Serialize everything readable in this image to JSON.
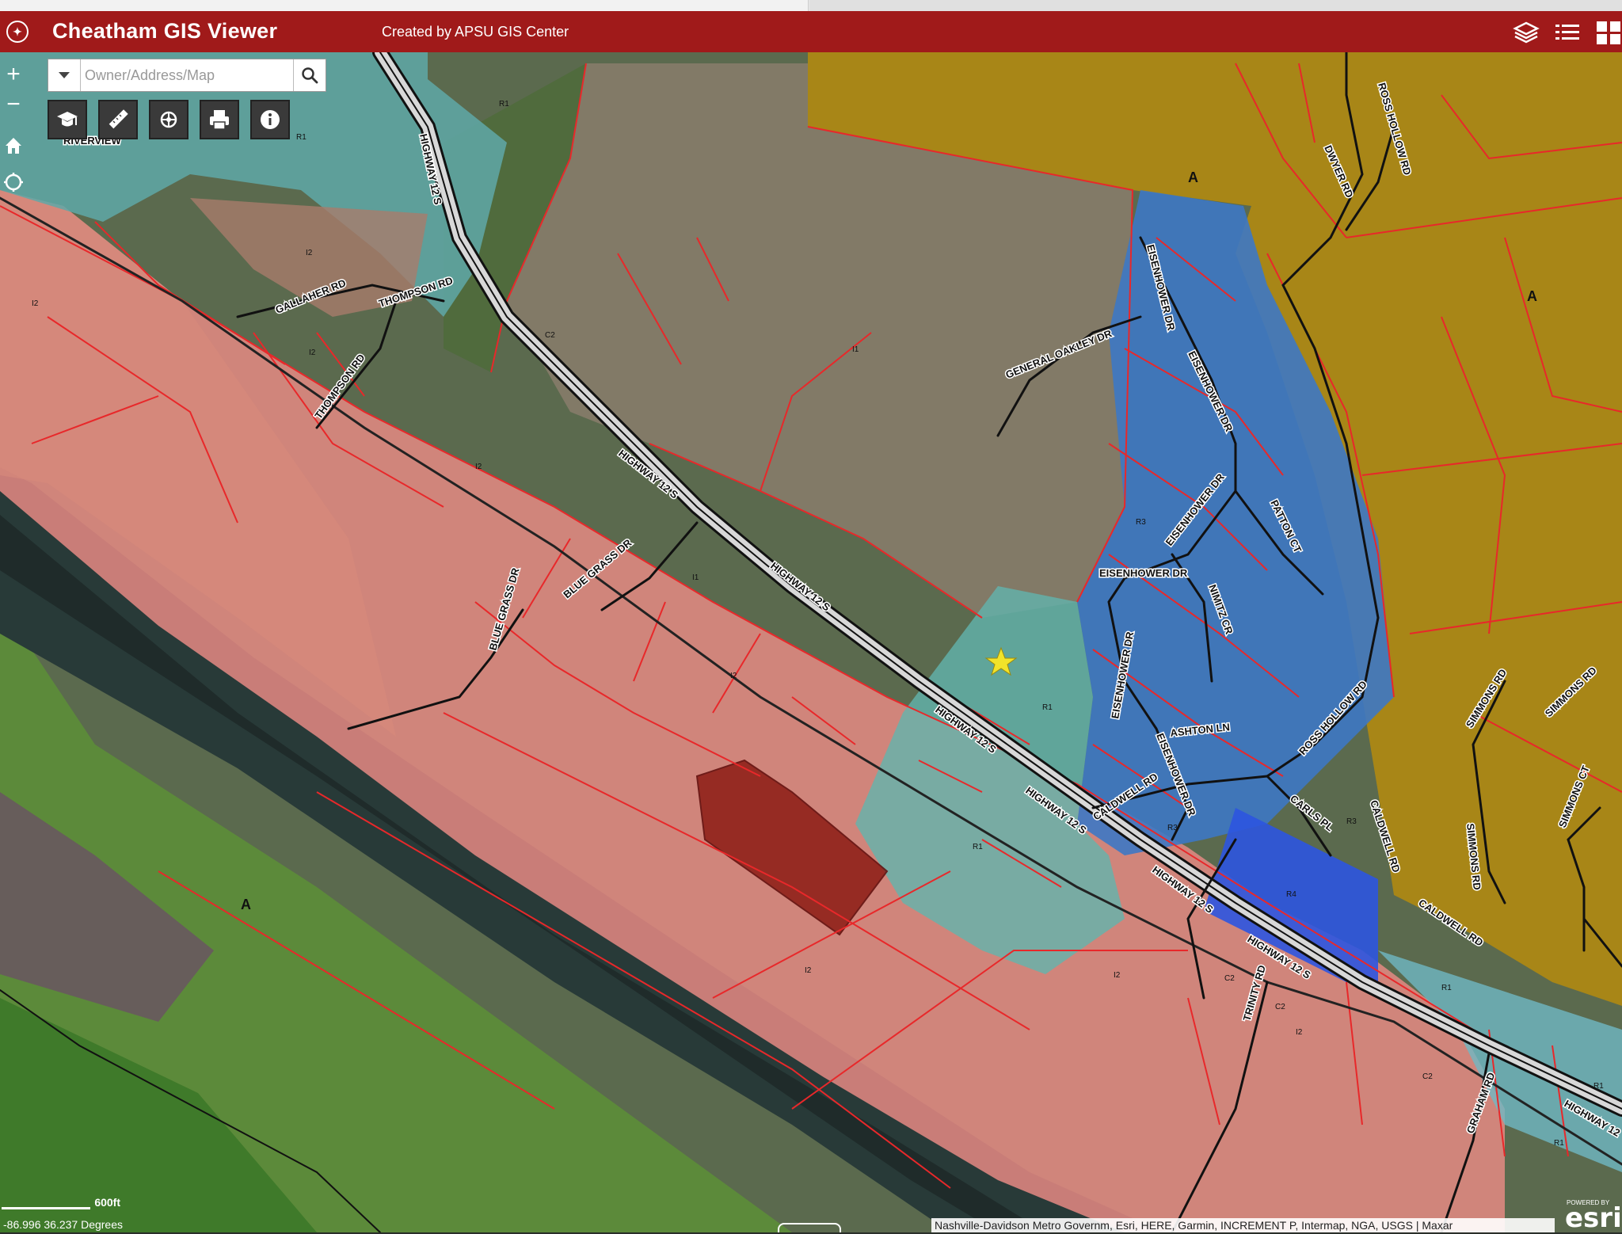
{
  "app": {
    "title": "Cheatham GIS Viewer",
    "subtitle": "Created by APSU GIS Center"
  },
  "header_icons": [
    "layers-icon",
    "legend-list-icon",
    "basemap-gallery-icon"
  ],
  "search": {
    "placeholder": "Owner/Address/Map"
  },
  "zoom": {
    "in_label": "+",
    "out_label": "−"
  },
  "toolbar_icons": [
    "graduation-cap-icon",
    "measure-ruler-icon",
    "draw-tools-icon",
    "print-icon",
    "info-icon"
  ],
  "side_icons": [
    "home-icon",
    "locate-icon"
  ],
  "map": {
    "zones": {
      "agricultural": "A",
      "industrial": [
        "I1",
        "I2"
      ],
      "commercial": [
        "C2"
      ],
      "residential": [
        "R1",
        "R3",
        "R4"
      ]
    },
    "road_labels": {
      "hwy12s": "HIGHWAY 12 S",
      "highway12": "HIGHWAY 12",
      "thompson": "THOMPSON RD",
      "gallaher": "GALLAHER RD",
      "bluegrass": "BLUE GRASS DR",
      "general_oakley": "GENERAL OAKLEY DR",
      "eisenhower": "EISENHOWER DR",
      "patton": "PATTON CT",
      "nimitz": "NIMITZ CR",
      "ashton": "ASHTON LN",
      "caldwell": "CALDWELL RD",
      "carls": "CARLS PL",
      "ross_hollow": "ROSS HOLLOW RD",
      "dwyer": "DWYER RD",
      "simmons_rd": "SIMMONS RD",
      "simmons_ct": "SIMMONS CT",
      "trinity": "TRINITY RD",
      "graham": "GRAHAM RD",
      "riverview": "RIVERVIEW"
    },
    "colors": {
      "industrial": "#e8908a",
      "agricultural": "#b8901a",
      "residential_r1": "#7fc8c0",
      "residential_r3": "#3f7fcf",
      "residential_r4": "#2c55e0",
      "parcel_line": "#e8282a",
      "header": "#a01a1a"
    }
  },
  "scale": {
    "label": "600ft"
  },
  "coordinates": "-86.996 36.237 Degrees",
  "attribution": "Nashville-Davidson Metro Governm, Esri, HERE, Garmin, INCREMENT P, Intermap, NGA, USGS | Maxar",
  "esri": {
    "powered": "POWERED BY",
    "name": "esri"
  }
}
